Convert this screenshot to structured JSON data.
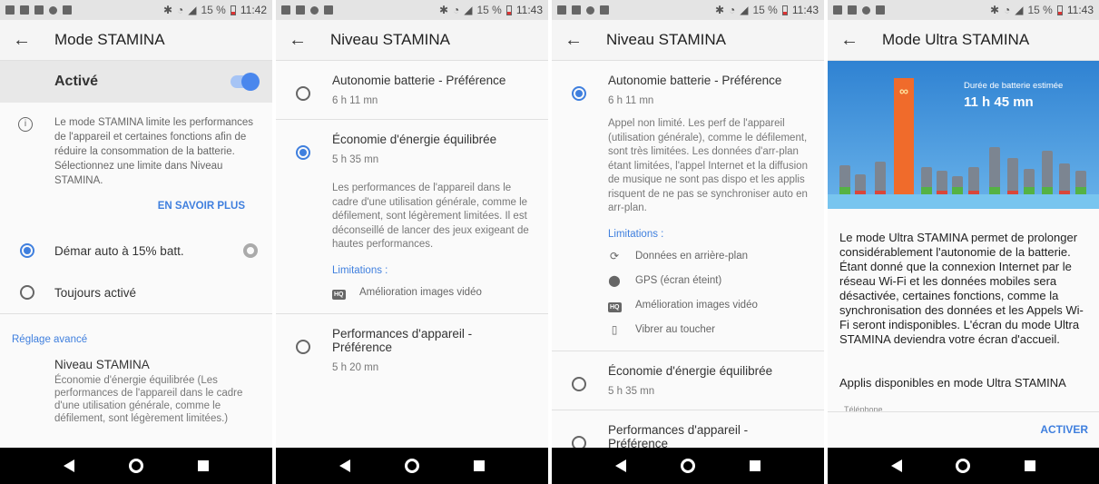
{
  "status_bar": {
    "battery": "15 %",
    "time_1": "11:42",
    "time_2": "11:43"
  },
  "screen1": {
    "title": "Mode STAMINA",
    "active_label": "Activé",
    "toggle_on": true,
    "info_text": "Le mode STAMINA limite les performances de l'appareil et certaines fonctions afin de réduire la consommation de la batterie. Sélectionnez une limite dans Niveau STAMINA.",
    "learn_more": "EN SAVOIR PLUS",
    "options": [
      {
        "label": "Démar auto à 15% batt.",
        "selected": true
      },
      {
        "label": "Toujours activé",
        "selected": false
      }
    ],
    "advanced_header": "Réglage avancé",
    "level_title": "Niveau STAMINA",
    "level_desc": "Économie d'énergie équilibrée (Les performances de l'appareil dans le cadre d'une utilisation générale, comme le défilement, sont légèrement limitées.)"
  },
  "screen2": {
    "title": "Niveau STAMINA",
    "options": [
      {
        "title": "Autonomie batterie - Préférence",
        "time": "6 h 11 mn",
        "selected": false
      },
      {
        "title": "Économie d'énergie équilibrée",
        "time": "5 h 35 mn",
        "selected": true,
        "desc": "Les performances de l'appareil dans le cadre d'une utilisation générale, comme le défilement, sont légèrement limitées. Il est déconseillé de lancer des jeux exigeant de hautes performances.",
        "limitations_label": "Limitations :",
        "limitations": [
          "Amélioration images vidéo"
        ]
      },
      {
        "title": "Performances d'appareil - Préférence",
        "time": "5 h 20 mn",
        "selected": false
      }
    ]
  },
  "screen3": {
    "title": "Niveau STAMINA",
    "options": [
      {
        "title": "Autonomie batterie - Préférence",
        "time": "6 h 11 mn",
        "selected": true,
        "desc": "Appel non limité. Les perf de l'appareil (utilisation générale), comme le défilement, sont très limitées. Les données d'arr-plan étant limitées, l'appel Internet et la diffusion de musique ne sont pas dispo et les applis risquent de ne pas se synchroniser auto en arr-plan.",
        "limitations_label": "Limitations :",
        "limitations": [
          {
            "icon": "sync-icon",
            "label": "Données en arrière-plan"
          },
          {
            "icon": "location-icon",
            "label": "GPS (écran éteint)"
          },
          {
            "icon": "hq-icon",
            "label": "Amélioration images vidéo"
          },
          {
            "icon": "vibrate-icon",
            "label": "Vibrer au toucher"
          }
        ]
      },
      {
        "title": "Économie d'énergie équilibrée",
        "time": "5 h 35 mn",
        "selected": false
      },
      {
        "title": "Performances d'appareil - Préférence",
        "selected": false
      }
    ]
  },
  "screen4": {
    "title": "Mode Ultra STAMINA",
    "estimate_label": "Durée de batterie estimée",
    "estimate_value": "11 h 45 mn",
    "description": "Le mode Ultra STAMINA permet de prolonger considérablement l'autonomie de la batterie. Étant donné que la connexion Internet par le réseau Wi-Fi et les données mobiles sera désactivée, certaines fonctions, comme la synchronisation des données et les Appels Wi-Fi seront indisponibles. L'écran du mode Ultra STAMINA deviendra votre écran d'accueil.",
    "apps_label": "Applis disponibles en mode Ultra STAMINA",
    "partial_item": "Téléphone",
    "activate_button": "ACTIVER"
  },
  "colors": {
    "accent": "#3f7fde",
    "toggle": "#4a87ed",
    "banner_top": "#2f82d2",
    "tower": "#f06b2b"
  }
}
